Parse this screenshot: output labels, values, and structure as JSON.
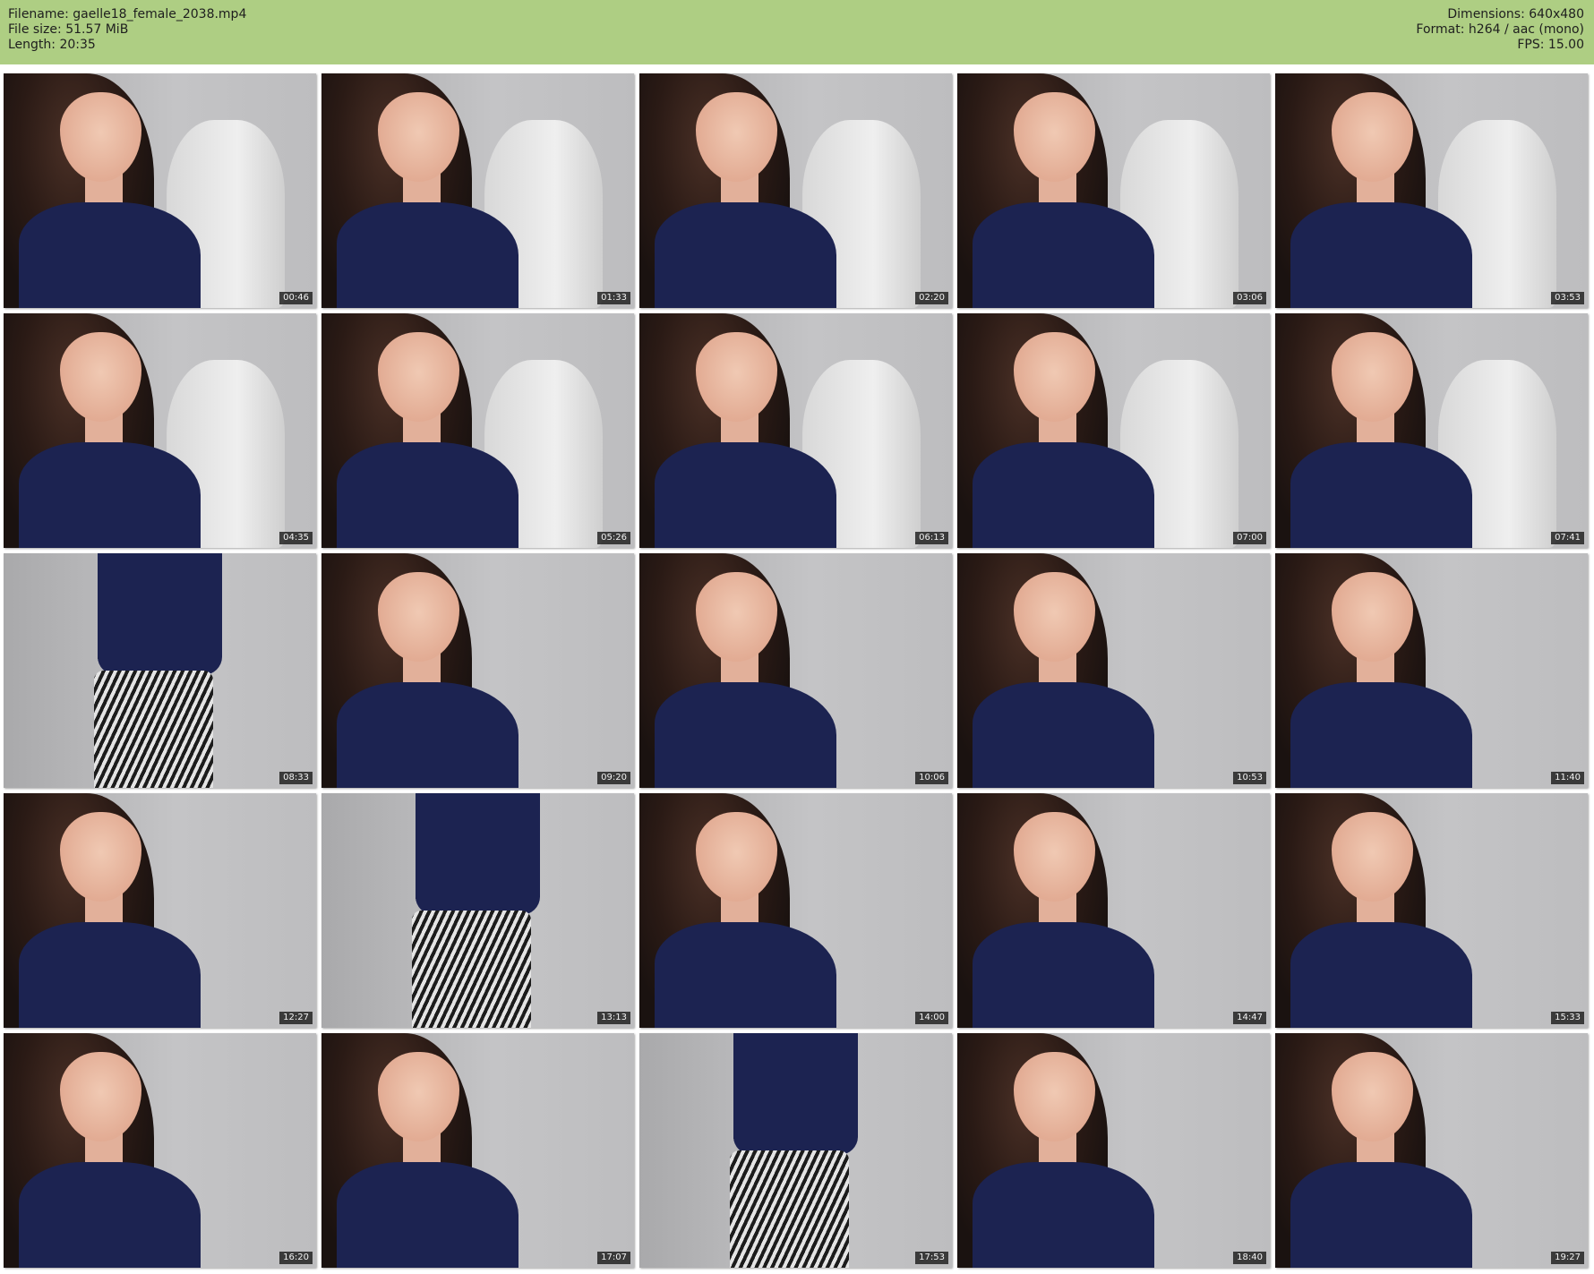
{
  "header": {
    "left": [
      "Filename: gaelle18_female_2038.mp4",
      "File size: 51.57 MiB",
      "Length: 20:35"
    ],
    "right": [
      "Dimensions: 640x480",
      "Format: h264 / aac (mono)",
      "FPS: 15.00"
    ]
  },
  "thumbnails": [
    {
      "time": "00:46",
      "scene": "face-chair"
    },
    {
      "time": "01:33",
      "scene": "face-chair"
    },
    {
      "time": "02:20",
      "scene": "face-chair"
    },
    {
      "time": "03:06",
      "scene": "face-chair"
    },
    {
      "time": "03:53",
      "scene": "face-chair"
    },
    {
      "time": "04:35",
      "scene": "face-chair"
    },
    {
      "time": "05:26",
      "scene": "face-chair"
    },
    {
      "time": "06:13",
      "scene": "face-chair"
    },
    {
      "time": "07:00",
      "scene": "face-chair"
    },
    {
      "time": "07:41",
      "scene": "face-chair"
    },
    {
      "time": "08:33",
      "scene": "skirt"
    },
    {
      "time": "09:20",
      "scene": "face"
    },
    {
      "time": "10:06",
      "scene": "face"
    },
    {
      "time": "10:53",
      "scene": "face"
    },
    {
      "time": "11:40",
      "scene": "face"
    },
    {
      "time": "12:27",
      "scene": "face"
    },
    {
      "time": "13:13",
      "scene": "skirt"
    },
    {
      "time": "14:00",
      "scene": "face"
    },
    {
      "time": "14:47",
      "scene": "face"
    },
    {
      "time": "15:33",
      "scene": "face"
    },
    {
      "time": "16:20",
      "scene": "face"
    },
    {
      "time": "17:07",
      "scene": "face"
    },
    {
      "time": "17:53",
      "scene": "skirt"
    },
    {
      "time": "18:40",
      "scene": "face"
    },
    {
      "time": "19:27",
      "scene": "face"
    }
  ]
}
